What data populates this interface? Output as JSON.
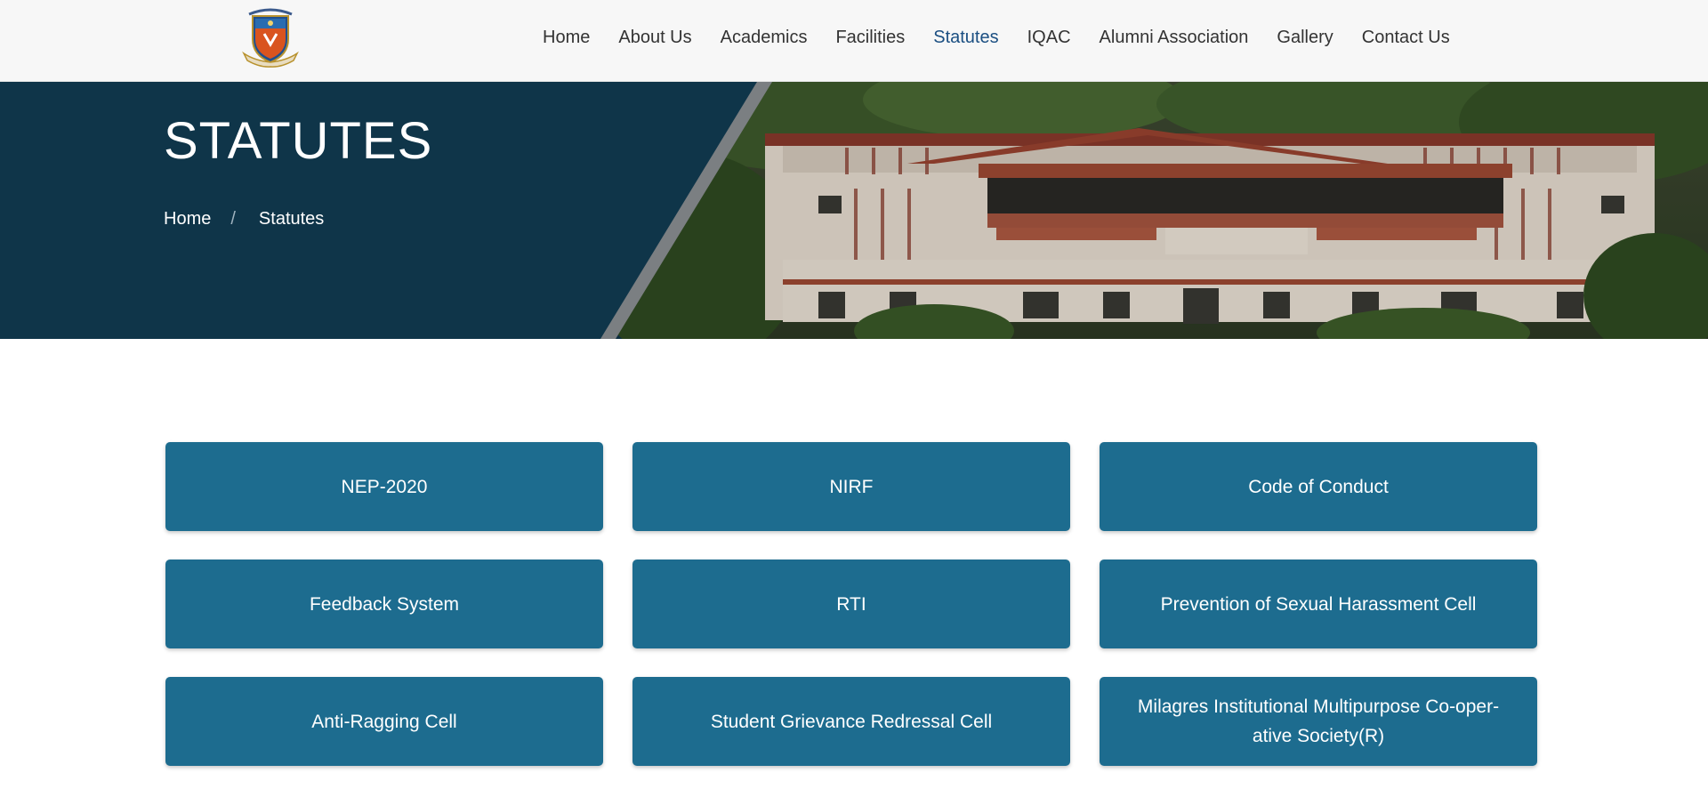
{
  "colors": {
    "header_bg": "#f7f7f7",
    "nav_text": "#333333",
    "nav_active": "#1b4f82",
    "banner_bg": "#0f3549",
    "card_bg": "#1d6c8f",
    "card_text": "#ffffff"
  },
  "header": {
    "logo_icon": "college-crest-icon",
    "nav": [
      {
        "label": "Home",
        "active": false
      },
      {
        "label": "About Us",
        "active": false
      },
      {
        "label": "Academics",
        "active": false
      },
      {
        "label": "Facilities",
        "active": false
      },
      {
        "label": "Statutes",
        "active": true
      },
      {
        "label": "IQAC",
        "active": false
      },
      {
        "label": "Alumni Association",
        "active": false
      },
      {
        "label": "Gallery",
        "active": false
      },
      {
        "label": "Contact Us",
        "active": false
      }
    ]
  },
  "banner": {
    "title": "STATUTES",
    "breadcrumb": {
      "home": "Home",
      "separator": "/",
      "current": "Statutes"
    }
  },
  "cards": [
    "NEP-2020",
    "NIRF",
    "Code of Conduct",
    "Feedback System",
    "RTI",
    "Prevention of Sexual Harassment Cell",
    "Anti-Ragging Cell",
    "Student Grievance Redressal Cell",
    "Milagres Institutional Multipurpose Co-oper-ative Society(R)"
  ]
}
